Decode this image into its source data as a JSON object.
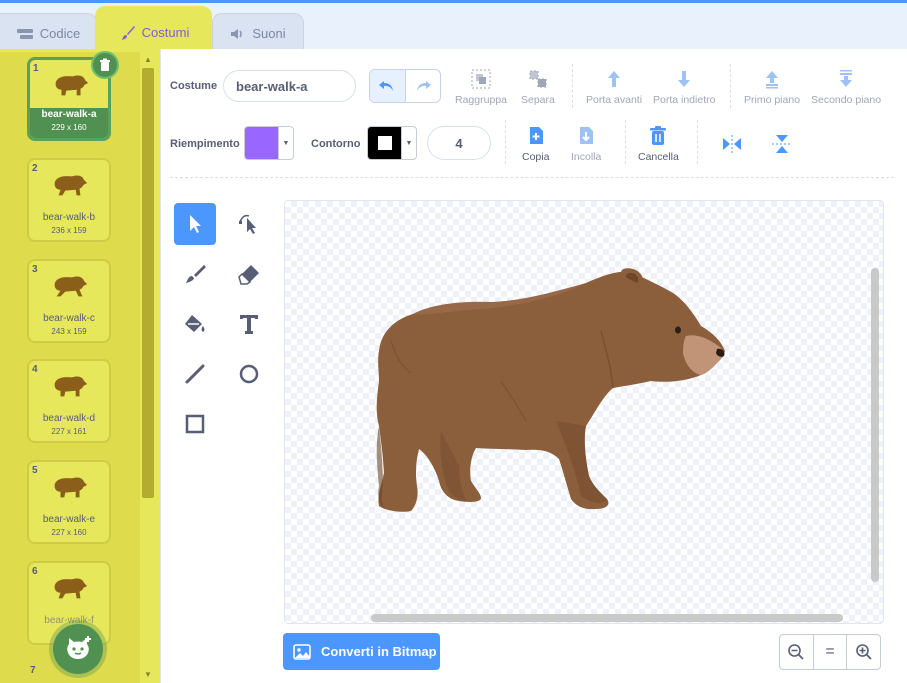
{
  "tabs": [
    {
      "label": "Codice",
      "icon": "code-icon"
    },
    {
      "label": "Costumi",
      "icon": "brush-icon",
      "selected": true
    },
    {
      "label": "Suoni",
      "icon": "speaker-icon"
    }
  ],
  "costumes": [
    {
      "num": "1",
      "name": "bear-walk-a",
      "size": "229 x 160",
      "selected": true
    },
    {
      "num": "2",
      "name": "bear-walk-b",
      "size": "236 x 159"
    },
    {
      "num": "3",
      "name": "bear-walk-c",
      "size": "243 x 159"
    },
    {
      "num": "4",
      "name": "bear-walk-d",
      "size": "227 x 161"
    },
    {
      "num": "5",
      "name": "bear-walk-e",
      "size": "227 x 160"
    },
    {
      "num": "6",
      "name": "bear-walk-f",
      "size": ""
    },
    {
      "num": "7"
    }
  ],
  "toolbar": {
    "costume_label": "Costume",
    "costume_name": "bear-walk-a",
    "group": "Raggruppa",
    "ungroup": "Separa",
    "forward": "Porta avanti",
    "backward": "Porta indietro",
    "front": "Primo piano",
    "back": "Secondo piano",
    "fill_label": "Riempimento",
    "fill_color": "#9966ff",
    "outline_label": "Contorno",
    "outline_color": "#000000",
    "outline_size": "4",
    "copy": "Copia",
    "paste": "Incolla",
    "delete": "Cancella"
  },
  "tools": [
    "select-tool",
    "reshape-tool",
    "brush-tool",
    "eraser-tool",
    "fill-tool",
    "text-tool",
    "line-tool",
    "circle-tool",
    "rectangle-tool"
  ],
  "footer": {
    "convert_label": "Converti in Bitmap",
    "zoom_out": "−",
    "zoom_reset": "=",
    "zoom_in": "+"
  },
  "colors": {
    "accent": "#4c97ff",
    "selection_yellow": "#e6e75a",
    "selected_green": "#509152",
    "bear_brown": "#8b5e3c"
  }
}
